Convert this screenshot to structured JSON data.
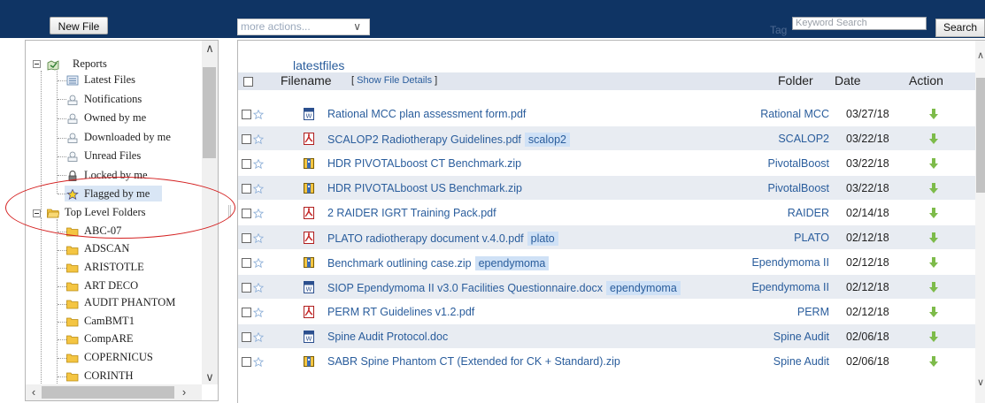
{
  "toolbar": {
    "new_file_label": "New File",
    "more_actions_placeholder": "more actions...",
    "tag_label": "Tag",
    "search_placeholder": "Keyword Search",
    "search_label": "Search"
  },
  "tree": {
    "root": "Reports",
    "report_items": [
      "Latest Files",
      "Notifications",
      "Owned by me",
      "Downloaded by me",
      "Unread Files",
      "Locked by me",
      "Flagged by me"
    ],
    "folders_root": "Top Level Folders",
    "folders": [
      "ABC-07",
      "ADSCAN",
      "ARISTOTLE",
      "ART DECO",
      "AUDIT PHANTOM",
      "CamBMT1",
      "CompARE",
      "COPERNICUS",
      "CORINTH"
    ]
  },
  "file_list": {
    "title": "latestfiles",
    "columns": {
      "filename": "Filename",
      "show_details": "Show File Details",
      "folder": "Folder",
      "date": "Date",
      "action": "Action"
    },
    "rows": [
      {
        "type": "word",
        "name": "Rational MCC plan assessment form.pdf",
        "tag": "",
        "folder": "Rational MCC",
        "date": "03/27/18"
      },
      {
        "type": "pdf",
        "name": "SCALOP2 Radiotherapy Guidelines.pdf",
        "tag": "scalop2",
        "folder": "SCALOP2",
        "date": "03/22/18"
      },
      {
        "type": "zip",
        "name": "HDR PIVOTALboost CT Benchmark.zip",
        "tag": "",
        "folder": "PivotalBoost",
        "date": "03/22/18"
      },
      {
        "type": "zip",
        "name": "HDR PIVOTALboost US Benchmark.zip",
        "tag": "",
        "folder": "PivotalBoost",
        "date": "03/22/18"
      },
      {
        "type": "pdf",
        "name": "2 RAIDER IGRT Training Pack.pdf",
        "tag": "",
        "folder": "RAIDER",
        "date": "02/14/18"
      },
      {
        "type": "pdf",
        "name": "PLATO radiotherapy document v.4.0.pdf",
        "tag": "plato",
        "folder": "PLATO",
        "date": "02/12/18"
      },
      {
        "type": "zip",
        "name": "Benchmark outlining case.zip",
        "tag": "ependymoma",
        "folder": "Ependymoma II",
        "date": "02/12/18"
      },
      {
        "type": "word",
        "name": "SIOP Ependymoma II v3.0 Facilities Questionnaire.docx",
        "tag": "ependymoma",
        "folder": "Ependymoma II",
        "date": "02/12/18"
      },
      {
        "type": "pdf",
        "name": "PERM RT Guidelines v1.2.pdf",
        "tag": "",
        "folder": "PERM",
        "date": "02/12/18"
      },
      {
        "type": "word",
        "name": "Spine Audit Protocol.doc",
        "tag": "",
        "folder": "Spine Audit",
        "date": "02/06/18"
      },
      {
        "type": "zip",
        "name": "SABR Spine Phantom CT (Extended for CK + Standard).zip",
        "tag": "",
        "folder": "Spine Audit",
        "date": "02/06/18"
      }
    ]
  },
  "colors": {
    "topbar": "#0f3464",
    "link": "#2a5d9c",
    "header_row": "#e1e6ef",
    "alt_row": "#e8ecf2",
    "tag_bg": "#cfe1f6",
    "annotation": "#d42020"
  }
}
